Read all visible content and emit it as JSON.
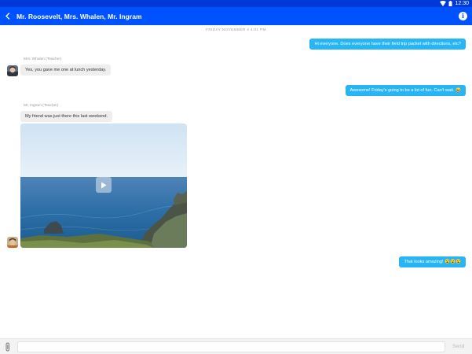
{
  "status_bar": {
    "time": "12:30"
  },
  "header": {
    "title": "Mr. Roosevelt, Mrs. Whalen, Mr. Ingram"
  },
  "chat": {
    "date_divider": "FRIDAY NOVEMBER 4 4:01 PM",
    "messages": [
      {
        "text": "Hi everyone. Does everyone have their field trip packet with directions, etc?"
      },
      {
        "sender": "Mrs. Whalen (Teacher)",
        "text": "Yes, you gave me one at lunch yesterday."
      },
      {
        "text": "Awesome! Friday's going to be a lot of fun. Can't wait. 😄"
      },
      {
        "sender": "Mr. Ingram (Teacher)",
        "text": "My friend was just there this last weekend."
      },
      {
        "text": "That looks amazing! 😮😮😮"
      }
    ]
  },
  "composer": {
    "placeholder": "",
    "send_label": "Send"
  },
  "colors": {
    "header": "#0052ff",
    "status_bar": "#0039d8",
    "outgoing_bubble": "#27b5f5",
    "incoming_bubble": "#eeeeee"
  }
}
